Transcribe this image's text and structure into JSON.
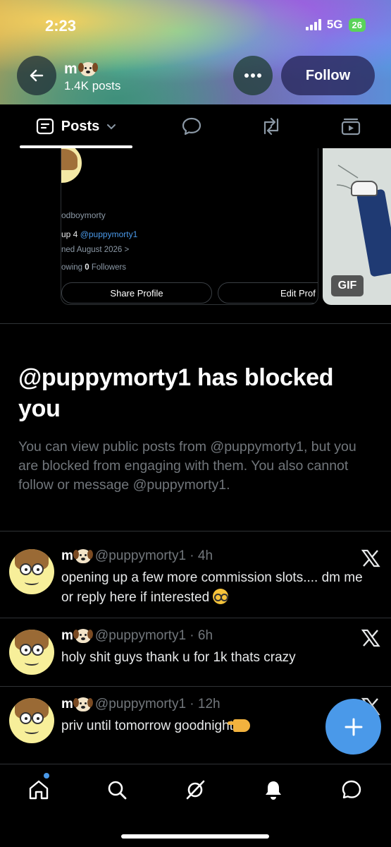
{
  "status_bar": {
    "time": "2:23",
    "network": "5G",
    "battery": "26"
  },
  "header": {
    "name": "m",
    "posts_count": "1.4K posts",
    "follow_label": "Follow"
  },
  "tabs": {
    "active_label": "Posts"
  },
  "profile_preview": {
    "handle": "odboymorty",
    "bio_prefix": "up 4 ",
    "bio_link": "@puppymorty1",
    "joined": "ned August 2026 >",
    "following_suffix": "owing ",
    "followers_count": "0",
    "followers_label": " Followers",
    "share_label": "Share Profile",
    "edit_label": "Edit Prof"
  },
  "gif_badge": "GIF",
  "blocked": {
    "title": "@puppymorty1 has blocked you",
    "body": "You can view public posts from @puppymorty1, but you are blocked from engaging with them. You also cannot follow or message @puppymorty1."
  },
  "posts": [
    {
      "name": "m",
      "meta": "@puppymorty1 · 4h",
      "text": "opening up a few more commission slots.... dm me or reply here if interested"
    },
    {
      "name": "m",
      "meta": "@puppymorty1 · 6h",
      "text": "holy shit guys thank u for 1k thats crazy"
    },
    {
      "name": "m",
      "meta": "@puppymorty1 · 12h",
      "text": "priv until tomorrow goodnight"
    }
  ],
  "icons": {
    "back": "arrow-left-icon",
    "more": "more-horizontal-icon",
    "posts_tab": "posts-list-icon",
    "replies_tab": "speech-bubble-icon",
    "reposts_tab": "repost-icon",
    "media_tab": "media-icon",
    "x_logo": "x-logo-icon",
    "compose": "plus-icon",
    "nav": [
      "home-icon",
      "search-icon",
      "grok-icon",
      "bell-icon",
      "messages-icon"
    ]
  },
  "colors": {
    "accent": "#4a99e9",
    "background": "#000000",
    "muted_text": "#71767b"
  }
}
